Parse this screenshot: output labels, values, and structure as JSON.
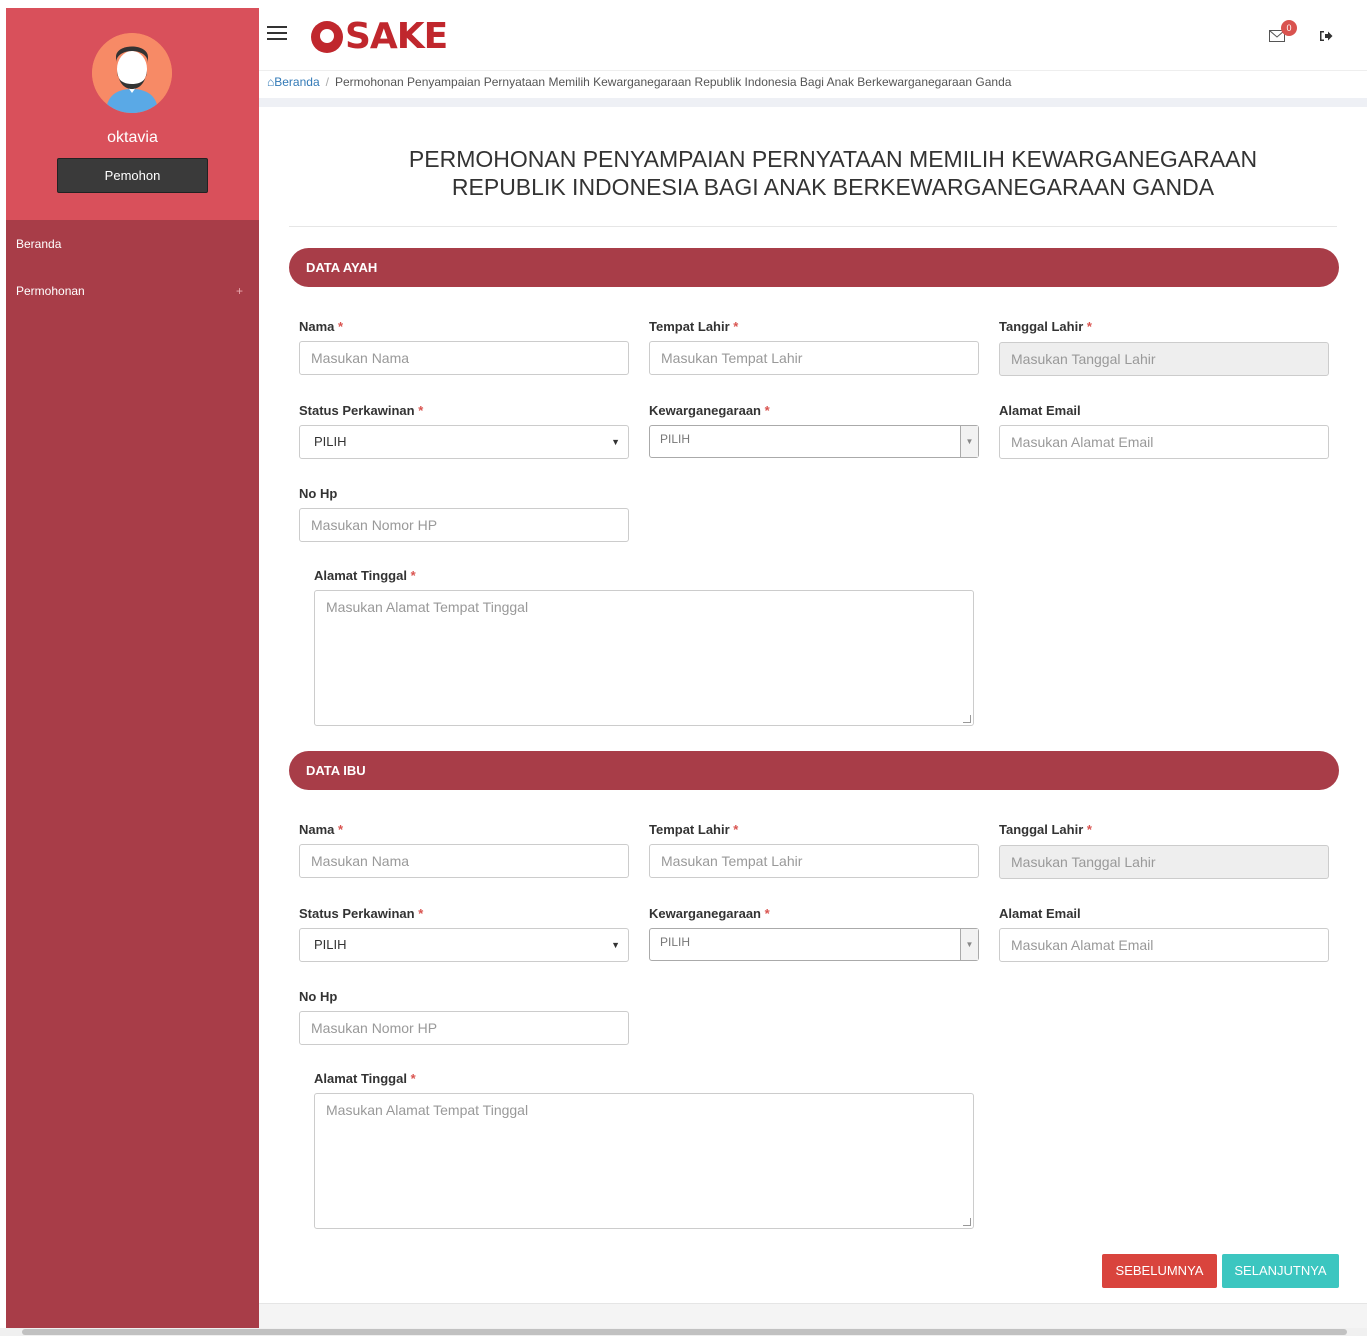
{
  "app": {
    "logo_text": "SAKE",
    "brand_color": "#c0272d",
    "sidebar_color": "#a83d48"
  },
  "user": {
    "name": "oktavia",
    "role": "Pemohon"
  },
  "sidebar": {
    "items": [
      {
        "label": "Beranda"
      },
      {
        "label": "Permohonan",
        "expand": "+"
      }
    ]
  },
  "header": {
    "notification_count": "0"
  },
  "breadcrumb": {
    "home": "Beranda",
    "current": "Permohonan Penyampaian Pernyataan Memilih Kewarganegaraan Republik Indonesia Bagi Anak Berkewarganegaraan Ganda"
  },
  "page": {
    "title_line1": "PERMOHONAN PENYAMPAIAN PERNYATAAN MEMILIH KEWARGANEGARAAN",
    "title_line2": "REPUBLIK INDONESIA BAGI ANAK BERKEWARGANEGARAAN GANDA"
  },
  "sections": [
    {
      "title": "DATA AYAH",
      "labels": {
        "nama": "Nama",
        "tempat_lahir": "Tempat Lahir",
        "tanggal_lahir": "Tanggal Lahir",
        "status": "Status Perkawinan",
        "kewarganegaraan": "Kewarganegaraan",
        "email": "Alamat Email",
        "hp": "No Hp",
        "alamat": "Alamat Tinggal"
      },
      "placeholders": {
        "nama": "Masukan Nama",
        "tempat_lahir": "Masukan Tempat Lahir",
        "tanggal_lahir": "Masukan Tanggal Lahir",
        "email": "Masukan Alamat Email",
        "hp": "Masukan Nomor HP",
        "alamat": "Masukan Alamat Tempat Tinggal"
      },
      "values": {
        "status": "PILIH",
        "kewarganegaraan": "PILIH"
      }
    },
    {
      "title": "DATA IBU",
      "labels": {
        "nama": "Nama",
        "tempat_lahir": "Tempat Lahir",
        "tanggal_lahir": "Tanggal Lahir",
        "status": "Status Perkawinan",
        "kewarganegaraan": "Kewarganegaraan",
        "email": "Alamat Email",
        "hp": "No Hp",
        "alamat": "Alamat Tinggal"
      },
      "placeholders": {
        "nama": "Masukan Nama",
        "tempat_lahir": "Masukan Tempat Lahir",
        "tanggal_lahir": "Masukan Tanggal Lahir",
        "email": "Masukan Alamat Email",
        "hp": "Masukan Nomor HP",
        "alamat": "Masukan Alamat Tempat Tinggal"
      },
      "values": {
        "status": "PILIH",
        "kewarganegaraan": "PILIH"
      }
    }
  ],
  "required_mark": "*",
  "actions": {
    "prev": "SEBELUMNYA",
    "next": "SELANJUTNYA"
  }
}
